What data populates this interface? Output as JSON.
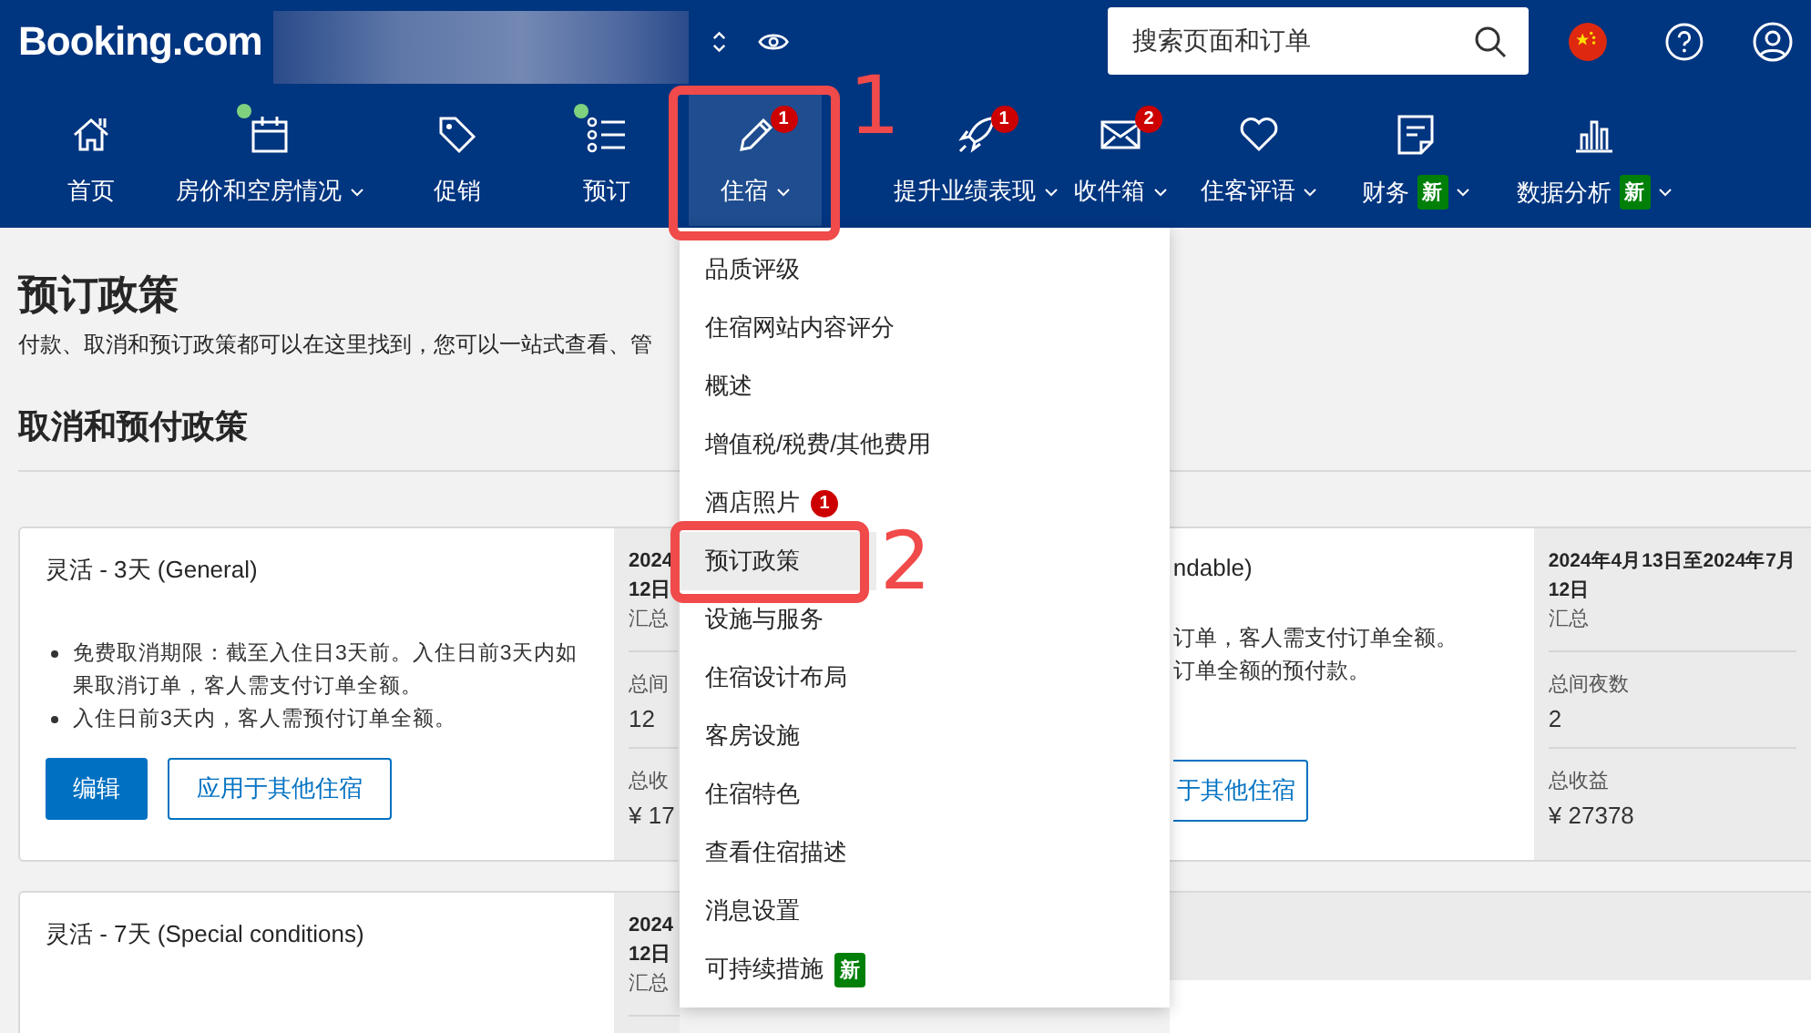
{
  "header": {
    "logo": "Booking.com",
    "search": {
      "placeholder": "搜索页面和订单"
    }
  },
  "nav": [
    {
      "label": "首页",
      "kind": "home",
      "dot": false,
      "caret": false,
      "selected": false
    },
    {
      "label": "房价和空房情况",
      "kind": "calendar",
      "dot": true,
      "caret": true,
      "selected": false
    },
    {
      "label": "促销",
      "kind": "tag",
      "dot": false,
      "caret": false,
      "selected": false
    },
    {
      "label": "预订",
      "kind": "list",
      "dot": true,
      "caret": false,
      "selected": false
    },
    {
      "label": "住宿",
      "kind": "pencil",
      "dot": false,
      "badge": "1",
      "caret": true,
      "selected": true
    },
    {
      "label": "提升业绩表现",
      "kind": "rocket",
      "dot": false,
      "badge": "1",
      "caret": true,
      "selected": false
    },
    {
      "label": "收件箱",
      "kind": "mail",
      "dot": false,
      "badge": "2",
      "caret": true,
      "selected": false
    },
    {
      "label": "住客评语",
      "kind": "heart",
      "dot": false,
      "caret": true,
      "selected": false
    },
    {
      "label": "财务",
      "kind": "doc",
      "dot": false,
      "tag": "新",
      "caret": true,
      "selected": false
    },
    {
      "label": "数据分析",
      "kind": "chart",
      "dot": false,
      "tag": "新",
      "caret": true,
      "selected": false
    }
  ],
  "page": {
    "title": "预订政策",
    "description": "付款、取消和预订政策都可以在这里找到，您可以一站式查看、管",
    "section_title": "取消和预付政策"
  },
  "cards": [
    {
      "title": "灵活 - 3天 (General)",
      "bullets": [
        "免费取消期限：截至入住日3天前。入住日前3天内如果取消订单，客人需支付订单全额。",
        "入住日前3天内，客人需预付订单全额。"
      ],
      "buttons": [
        {
          "label": "编辑",
          "kind": "primary"
        },
        {
          "label": "应用于其他住宿",
          "kind": "outline"
        }
      ],
      "summary": {
        "date": [
          "2024",
          "12日"
        ],
        "label": "汇总",
        "stats": [
          {
            "label": "总间",
            "value": "12"
          },
          {
            "label": "总收",
            "value": "¥ 17"
          }
        ]
      }
    },
    {
      "title": "ndable)",
      "lines": [
        "订单，客人需支付订单全额。",
        "订单全额的预付款。"
      ],
      "buttons": [
        {
          "label": "于其他住宿",
          "kind": "outline"
        }
      ],
      "summary": {
        "date": [
          "2024年4月13日至2024年7月",
          "12日"
        ],
        "label": "汇总",
        "stats": [
          {
            "label": "总间夜数",
            "value": "2"
          },
          {
            "label": "总收益",
            "value": "¥ 27378"
          }
        ]
      }
    },
    {
      "title": "灵活 - 7天 (Special conditions)",
      "summary": {
        "date": [
          "2024",
          "12日"
        ],
        "label": "汇总"
      }
    }
  ],
  "menu": [
    {
      "label": "品质评级",
      "selected": false
    },
    {
      "label": "住宿网站内容评分",
      "selected": false
    },
    {
      "label": "概述",
      "selected": false
    },
    {
      "label": "增值税/税费/其他费用",
      "selected": false
    },
    {
      "label": "酒店照片",
      "badge": "1",
      "selected": false
    },
    {
      "label": "预订政策",
      "selected": true
    },
    {
      "label": "设施与服务",
      "selected": false
    },
    {
      "label": "住宿设计布局",
      "selected": false
    },
    {
      "label": "客房设施",
      "selected": false
    },
    {
      "label": "住宿特色",
      "selected": false
    },
    {
      "label": "查看住宿描述",
      "selected": false
    },
    {
      "label": "消息设置",
      "selected": false
    },
    {
      "label": "可持续措施",
      "tag": "新",
      "selected": false
    }
  ],
  "annotations": [
    {
      "text": "1"
    },
    {
      "text": "2"
    }
  ]
}
